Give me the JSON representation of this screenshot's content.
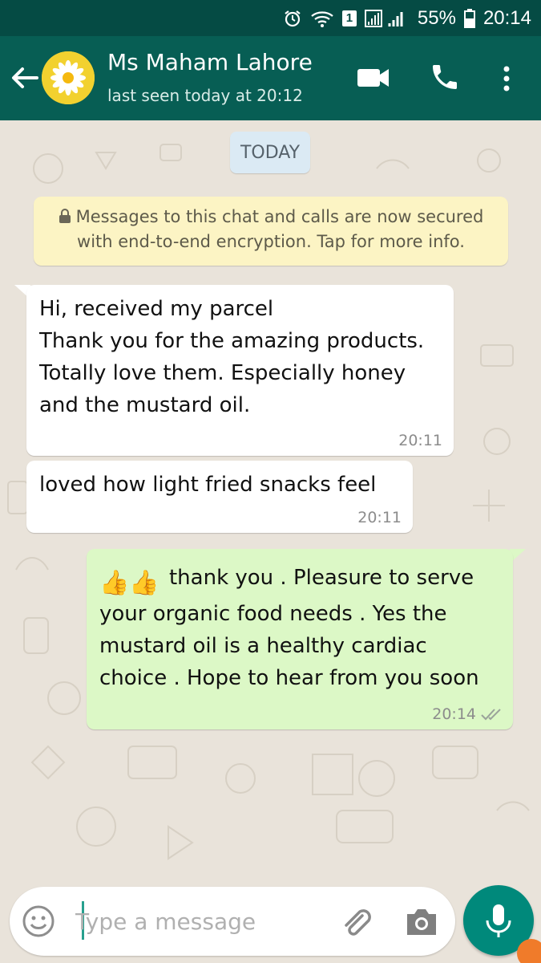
{
  "status_bar": {
    "sim_badge": "1",
    "battery_percent": "55%",
    "time": "20:14"
  },
  "header": {
    "contact_name": "Ms Maham Lahore",
    "last_seen": "last seen today at 20:12",
    "icons": [
      "back-arrow-icon",
      "avatar-daisy",
      "video-call-icon",
      "phone-icon",
      "more-vert-icon"
    ]
  },
  "chat": {
    "date_label": "TODAY",
    "encryption_notice": "Messages to this chat and calls are now secured with end-to-end encryption. Tap for more info.",
    "messages": [
      {
        "direction": "incoming",
        "text": "Hi, received my parcel\nThank you for the amazing products. Totally love them. Especially honey and the mustard oil.",
        "time": "20:11"
      },
      {
        "direction": "incoming",
        "text": "loved how light fried snacks feel",
        "time": "20:11"
      },
      {
        "direction": "outgoing",
        "emoji": "👍👍",
        "text": "thank you . Pleasure to serve your organic food needs . Yes the mustard oil is a healthy cardiac choice . Hope to hear from you soon",
        "time": "20:14",
        "status": "read-double-tick"
      }
    ]
  },
  "composer": {
    "placeholder": "Type a message"
  },
  "colors": {
    "status_bar": "#054b44",
    "app_bar": "#075e54",
    "chat_background": "#e9e3da",
    "incoming_bubble": "#ffffff",
    "outgoing_bubble": "#dcf8c6",
    "date_chip": "#dbeaf4",
    "encryption_notice": "#fcf4c4",
    "mic_button": "#00897b"
  }
}
